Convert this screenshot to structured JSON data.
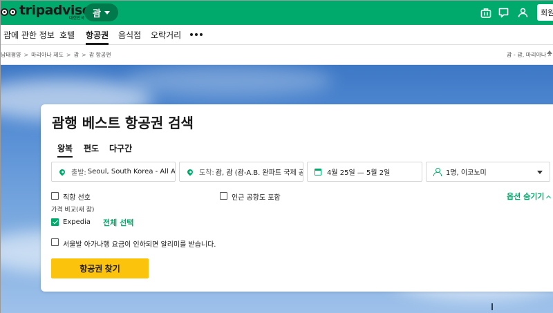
{
  "header": {
    "brand_prefix": "trip",
    "brand_suffix": "advisor",
    "brand_sub": "대한민국",
    "region_label": "괌",
    "login_label": "회원"
  },
  "nav": {
    "items": [
      "괌에 관한 정보",
      "호텔",
      "항공권",
      "음식점",
      "오락거리"
    ],
    "active": "항공권"
  },
  "breadcrumb": {
    "items": [
      "남태평양",
      "마리아나 제도",
      "괌",
      "괌 항공편"
    ],
    "separator": ">",
    "right_text": "괌 - 괌, 마리아나 제도"
  },
  "search_card": {
    "title": "괌행 베스트 항공권 검색",
    "trip_types": [
      "왕복",
      "편도",
      "다구간"
    ],
    "active_trip_type": "왕복",
    "origin_label": "출발:",
    "origin_value": "Seoul, South Korea - All Airports",
    "destination_label": "도착:",
    "destination_value": "괌, 괌 (괌-A.B. 완파트 국제 공항)",
    "dates": "4월 25일 — 5월 2일",
    "passengers": "1명, 이코노미",
    "direct_pref": "직항 선호",
    "nearby_airports": "인근 공항도 포함",
    "hide_options": "옵션 숨기기",
    "price_compare": "가격 비교(새 창)",
    "expedia": "Expedia",
    "select_all": "전체 선택",
    "alert_text": "서울발 아가나행 요금이 인하되면 알리미를 받습니다.",
    "search_button": "항공권 찾기"
  },
  "colors": {
    "brand_green": "#00aa6c",
    "button_yellow": "#fcc30d"
  }
}
